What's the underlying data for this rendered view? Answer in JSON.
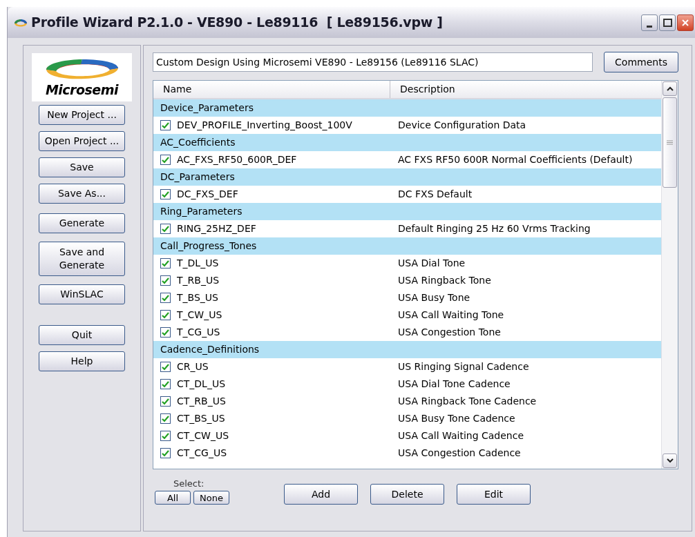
{
  "window": {
    "title": "Profile Wizard P2.1.0 - VE890 - Le89116  [ Le89156.vpw ]"
  },
  "logo": {
    "text": "Microsemi"
  },
  "sidebar": {
    "buttons": [
      {
        "label": "New Project ...",
        "kind": "single"
      },
      {
        "label": "Open Project ...",
        "kind": "single"
      },
      {
        "label": "Save",
        "kind": "single"
      },
      {
        "label": "Save As...",
        "kind": "single"
      },
      {
        "label": "Generate",
        "kind": "single"
      },
      {
        "label": "Save and Generate",
        "kind": "double"
      },
      {
        "label": "WinSLAC",
        "kind": "single"
      },
      {
        "label": "Quit",
        "kind": "single"
      },
      {
        "label": "Help",
        "kind": "single"
      }
    ]
  },
  "design_name": {
    "value": "Custom Design Using Microsemi VE890 - Le89156 (Le89116 SLAC)"
  },
  "comments_button": "Comments",
  "table": {
    "columns": [
      "Name",
      "Description"
    ],
    "groups": [
      {
        "name": "Device_Parameters",
        "items": [
          {
            "checked": true,
            "name": "DEV_PROFILE_Inverting_Boost_100V",
            "description": "Device Configuration Data"
          }
        ]
      },
      {
        "name": "AC_Coefficients",
        "items": [
          {
            "checked": true,
            "name": "AC_FXS_RF50_600R_DEF",
            "description": "AC FXS RF50 600R Normal Coefficients (Default)"
          }
        ]
      },
      {
        "name": "DC_Parameters",
        "items": [
          {
            "checked": true,
            "name": "DC_FXS_DEF",
            "description": "DC FXS Default"
          }
        ]
      },
      {
        "name": "Ring_Parameters",
        "items": [
          {
            "checked": true,
            "name": "RING_25HZ_DEF",
            "description": "Default Ringing 25 Hz 60 Vrms Tracking"
          }
        ]
      },
      {
        "name": "Call_Progress_Tones",
        "items": [
          {
            "checked": true,
            "name": "T_DL_US",
            "description": "USA Dial Tone"
          },
          {
            "checked": true,
            "name": "T_RB_US",
            "description": "USA Ringback Tone"
          },
          {
            "checked": true,
            "name": "T_BS_US",
            "description": "USA Busy Tone"
          },
          {
            "checked": true,
            "name": "T_CW_US",
            "description": "USA Call Waiting Tone"
          },
          {
            "checked": true,
            "name": "T_CG_US",
            "description": "USA Congestion Tone"
          }
        ]
      },
      {
        "name": "Cadence_Definitions",
        "items": [
          {
            "checked": true,
            "name": "CR_US",
            "description": "US Ringing Signal Cadence"
          },
          {
            "checked": true,
            "name": "CT_DL_US",
            "description": "USA Dial Tone Cadence"
          },
          {
            "checked": true,
            "name": "CT_RB_US",
            "description": "USA Ringback Tone Cadence"
          },
          {
            "checked": true,
            "name": "CT_BS_US",
            "description": "USA Busy Tone Cadence"
          },
          {
            "checked": true,
            "name": "CT_CW_US",
            "description": "USA Call Waiting Cadence"
          },
          {
            "checked": true,
            "name": "CT_CG_US",
            "description": "USA Congestion Cadence"
          }
        ]
      }
    ]
  },
  "select": {
    "label": "Select:",
    "buttons": [
      "All",
      "None"
    ]
  },
  "actions": [
    "Add",
    "Delete",
    "Edit"
  ]
}
